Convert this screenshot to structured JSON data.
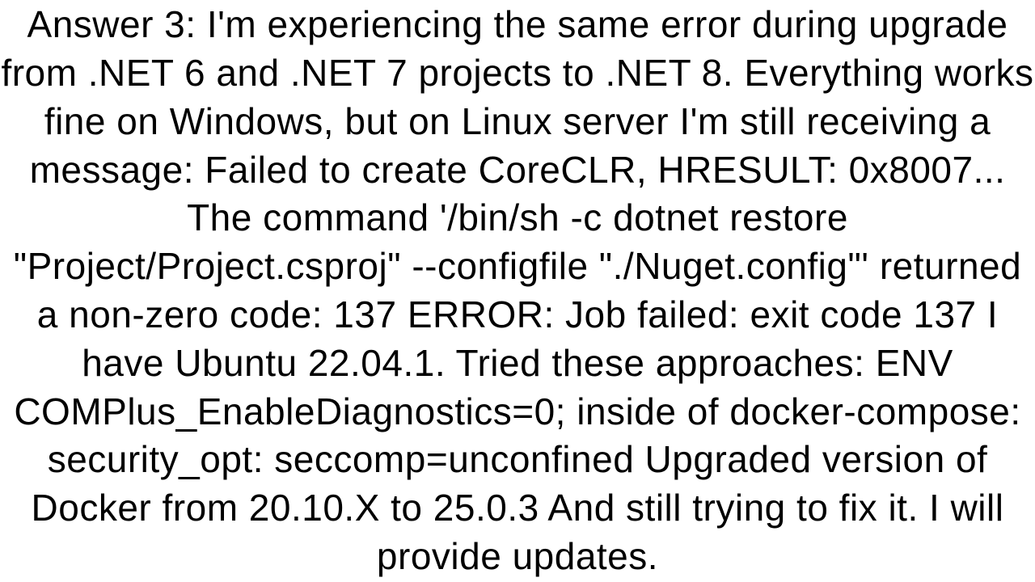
{
  "answer": {
    "text": "Answer 3: I'm experiencing the same error during upgrade from .NET 6 and .NET 7 projects to .NET 8. Everything works fine on Windows, but on Linux server I'm still receiving a message:  Failed to create CoreCLR, HRESULT: 0x8007... The command '/bin/sh -c dotnet restore \"Project/Project.csproj\" --configfile \"./Nuget.config\"' returned a non-zero code: 137 ERROR: Job failed: exit code 137  I have Ubuntu 22.04.1. Tried these approaches:  ENV COMPlus_EnableDiagnostics=0;  inside of docker-compose: security_opt:  seccomp=unconfined   Upgraded version of Docker from 20.10.X to 25.0.3   And still trying to fix it. I will provide updates."
  }
}
